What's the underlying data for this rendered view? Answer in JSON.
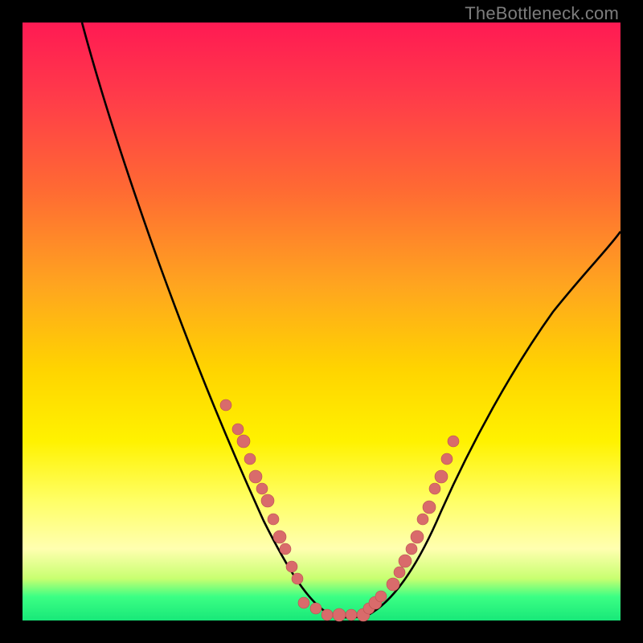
{
  "watermark": "TheBottleneck.com",
  "colors": {
    "frame": "#000000",
    "curve": "#000000",
    "dot_fill": "#d96b6b",
    "dot_stroke": "#b94f4f",
    "gradient_stops": [
      "#ff1a53",
      "#ff3a4a",
      "#ff6a33",
      "#ffa51f",
      "#ffd400",
      "#fff200",
      "#ffff66",
      "#ffffb0",
      "#c8ff70",
      "#3cff84",
      "#18e879"
    ]
  },
  "chart_data": {
    "type": "line",
    "title": "",
    "xlabel": "",
    "ylabel": "",
    "xlim": [
      0,
      100
    ],
    "ylim": [
      0,
      100
    ],
    "note": "Axes are unlabeled in the image; x and y are normalized 0–100 readings from pixel position inside the 744×744 plot.",
    "series": [
      {
        "name": "main-curve",
        "style": "line",
        "x": [
          10,
          12,
          16,
          20,
          25,
          30,
          35,
          40,
          44,
          47,
          50,
          52,
          55,
          58,
          62,
          66,
          70,
          74,
          78,
          84,
          90,
          96,
          100
        ],
        "y": [
          100,
          93,
          82,
          72,
          60,
          47,
          35,
          24,
          14,
          8,
          3,
          1,
          1,
          2,
          5,
          10,
          17,
          24,
          32,
          43,
          53,
          62,
          68
        ]
      },
      {
        "name": "scatter-left-wall",
        "style": "scatter",
        "x": [
          34,
          36,
          37,
          38,
          39,
          40,
          41,
          42,
          43,
          44,
          45,
          46
        ],
        "y": [
          36,
          32,
          30,
          27,
          24,
          22,
          20,
          17,
          14,
          12,
          9,
          7
        ]
      },
      {
        "name": "scatter-valley",
        "style": "scatter",
        "x": [
          47,
          49,
          51,
          53,
          55,
          57,
          58,
          59,
          60,
          62
        ],
        "y": [
          3,
          2,
          1,
          1,
          1,
          1,
          2,
          3,
          4,
          6
        ]
      },
      {
        "name": "scatter-right-wall",
        "style": "scatter",
        "x": [
          63,
          64,
          65,
          66,
          67,
          68,
          69,
          70,
          71,
          72
        ],
        "y": [
          8,
          10,
          12,
          14,
          17,
          19,
          22,
          24,
          27,
          30
        ]
      }
    ]
  }
}
